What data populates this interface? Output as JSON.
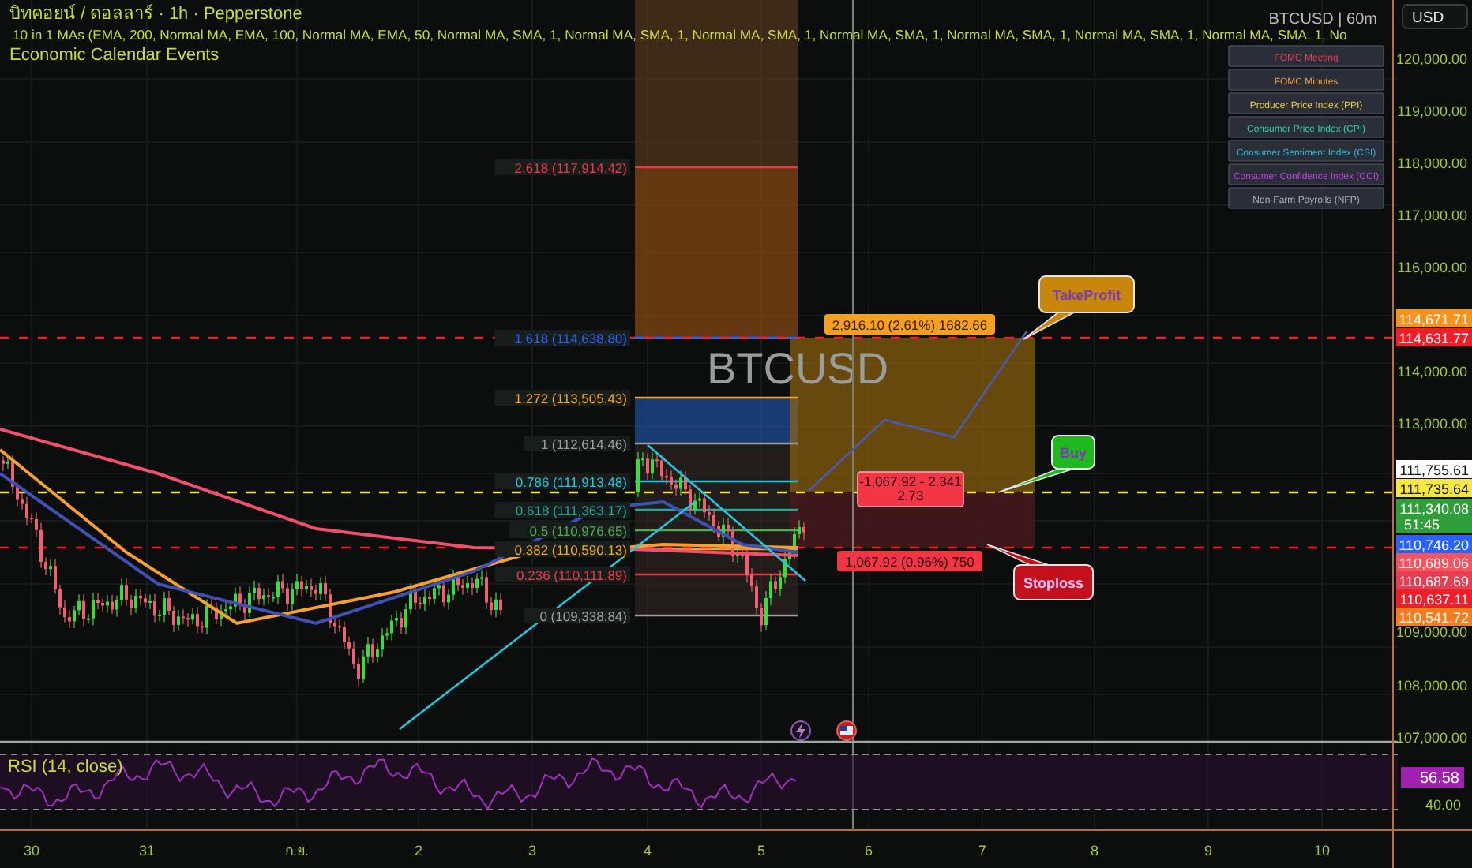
{
  "header": {
    "symbol_line": "บิทคอยน์ / ดอลลาร์ · 1h · Pepperstone",
    "indicator_line": "10 in 1 MAs (EMA, 200, Normal MA, EMA, 100, Normal MA, EMA, 50, Normal MA, SMA, 1, Normal MA, SMA, 1, Normal MA, SMA, 1, Normal MA, SMA, 1, Normal MA, SMA, 1, Normal MA, SMA, 1, Normal MA, SMA, 1, No",
    "events_line": "Economic Calendar Events"
  },
  "symbol_badge": "BTCUSD | 60m",
  "watermark_symbol": "BTCUSD",
  "currency_button": "USD",
  "economic_legend": [
    {
      "label": "FOMC Meeting",
      "color": "#e0405a"
    },
    {
      "label": "FOMC Minutes",
      "color": "#e8a040"
    },
    {
      "label": "Producer Price Index (PPI)",
      "color": "#e8d040"
    },
    {
      "label": "Consumer Price Index (CPI)",
      "color": "#30d0a0"
    },
    {
      "label": "Consumer Sentiment Index (CSI)",
      "color": "#30b8d8"
    },
    {
      "label": "Consumer Confidence Index (CCI)",
      "color": "#c040e0"
    },
    {
      "label": "Non-Farm Payrolls (NFP)",
      "color": "#b0b0b0"
    }
  ],
  "price_axis": [
    "120,000.00",
    "119,000.00",
    "118,000.00",
    "117,000.00",
    "116,000.00",
    "114,000.00",
    "113,000.00",
    "109,000.00",
    "108,000.00",
    "107,000.00"
  ],
  "price_tags": [
    {
      "text": "114,671.71",
      "color": "#f7931a"
    },
    {
      "text": "114,631.77",
      "color": "#f01e28"
    },
    {
      "text": "111,755.61",
      "color": "#ffffff"
    },
    {
      "text": "111,735.64",
      "color": "#f5e642"
    },
    {
      "text": "111,340.08",
      "subtext": "51:45",
      "color": "#2e9e3a"
    },
    {
      "text": "110,746.20",
      "color": "#2962ff"
    },
    {
      "text": "110,689.06",
      "color": "#f2555f"
    },
    {
      "text": "110,687.69",
      "color": "#e83c50"
    },
    {
      "text": "110,637.11",
      "color": "#f01e28"
    },
    {
      "text": "110,541.72",
      "color": "#f57c1f"
    }
  ],
  "fib_levels": [
    {
      "label": "2.618 (117,914.42)",
      "color": "#f23645"
    },
    {
      "label": "1.618 (114,638.80)",
      "color": "#2962ff"
    },
    {
      "label": "1.272 (113,505.43)",
      "color": "#f5a623"
    },
    {
      "label": "1 (112,614.46)",
      "color": "#9e9e9e"
    },
    {
      "label": "0.786 (111,913.48)",
      "color": "#26c6da"
    },
    {
      "label": "0.618 (111,363.17)",
      "color": "#26a69a"
    },
    {
      "label": "0.5 (110,976.65)",
      "color": "#4caf50"
    },
    {
      "label": "0.382 (110,590.13)",
      "color": "#f5a623"
    },
    {
      "label": "0.236 (110,111.89)",
      "color": "#f23645"
    },
    {
      "label": "0 (109,338.84)",
      "color": "#9e9e9e"
    }
  ],
  "position": {
    "target_label": "2,916.10 (2.61%) 1682.66",
    "entry_label": [
      "-1,067.92 - 2.341",
      "2.73"
    ],
    "stop_label": "1,067.92 (0.96%) 750"
  },
  "callouts": [
    {
      "text": "TakeProfit",
      "color": "#c8860a"
    },
    {
      "text": "Buy",
      "color": "#1fb81f"
    },
    {
      "text": "Stoploss",
      "color": "#c4101c"
    }
  ],
  "rsi": {
    "label": "RSI (14, close)",
    "value": "56.58",
    "axis": [
      "40.00"
    ]
  },
  "time_axis": [
    "30",
    "31",
    "ก.ย.",
    "2",
    "3",
    "4",
    "5",
    "6",
    "7",
    "8",
    "9",
    "10"
  ]
}
